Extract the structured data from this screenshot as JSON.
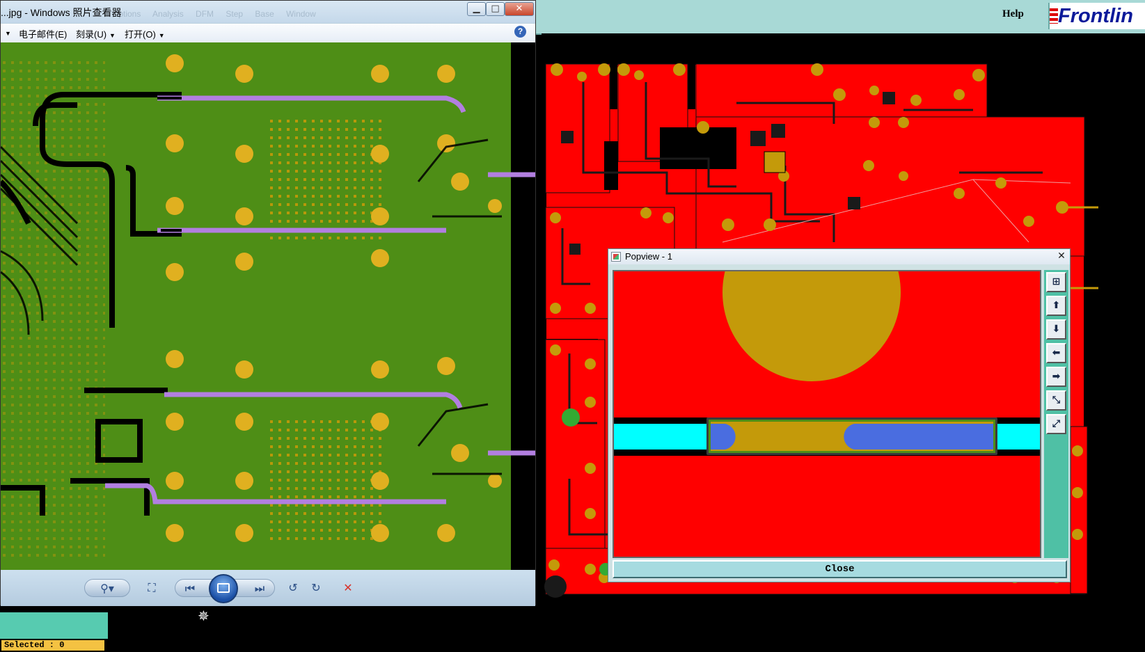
{
  "frontline": {
    "help_label": "Help",
    "logo_text": "Frontlin",
    "status_text": "Selected : 0",
    "cursor_icon": "crosshair-cursor-icon"
  },
  "photo_viewer": {
    "title": "...jpg - Windows 照片查看器",
    "ghost_menu_text": "Options Analysis DFM Step Base Window",
    "window_controls": {
      "minimize": "▁",
      "maximize": "□",
      "close": "✕"
    },
    "menu": [
      {
        "label": "电子邮件(E)"
      },
      {
        "label": "刻录(U)"
      },
      {
        "label": "打开(O)"
      }
    ],
    "help_icon": "?",
    "toolbar": {
      "zoom_icon": "magnifier-icon",
      "fit_icon": "fit-window-icon",
      "previous_icon": "previous-icon",
      "slideshow_icon": "slideshow-icon",
      "next_icon": "next-icon",
      "rotate_ccw_icon": "rotate-ccw-icon",
      "rotate_cw_icon": "rotate-cw-icon",
      "delete_icon": "delete-icon"
    }
  },
  "popview": {
    "title": "Popview - 1",
    "close_x": "✕",
    "close_button_label": "Close",
    "side_buttons": [
      "zoom-fit-icon",
      "pan-up-icon",
      "pan-down-icon",
      "pan-left-icon",
      "pan-right-icon",
      "zoom-out-icon",
      "zoom-in-icon"
    ]
  },
  "colors": {
    "pcb_red": "#ff0000",
    "pcb_green": "#4e8e16",
    "pad_gold": "#c49a0a",
    "trace_purple": "#b27fe0",
    "cyan": "#00ffff",
    "blue": "#4a6de0",
    "frontline_teal": "#a8d9d6"
  }
}
